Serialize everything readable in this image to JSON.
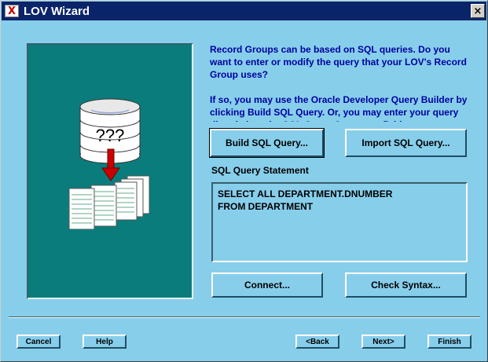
{
  "window": {
    "title": "LOV Wizard",
    "close_glyph": "×",
    "app_icon_glyph": "X",
    "icon": "oracle-forms-icon"
  },
  "instructions": {
    "paragraph1": "Record Groups can be based on SQL queries. Do you want to enter or modify the query that your LOV's Record Group uses?",
    "paragraph2": "If so, you may use the Oracle Developer Query Builder by clicking Build SQL Query. Or, you may enter your query directly into the SQL Query Statement field."
  },
  "illustration": {
    "database_label": "???",
    "icon": "database-to-records-illustration"
  },
  "buttons": {
    "build_sql": "Build SQL Query...",
    "import_sql": "Import SQL Query...",
    "connect": "Connect...",
    "check_syntax": "Check Syntax..."
  },
  "sql": {
    "label": "SQL Query Statement",
    "statement": "SELECT ALL DEPARTMENT.DNUMBER\nFROM DEPARTMENT"
  },
  "footer": {
    "cancel": "Cancel",
    "help": "Help",
    "back": "<Back",
    "next": "Next>",
    "finish": "Finish"
  },
  "colors": {
    "background": "#87ceeb",
    "title_bar": "#0a246a",
    "panel": "#0a7c7c",
    "instruction_text": "#0000a0",
    "arrow": "#cc0000"
  }
}
